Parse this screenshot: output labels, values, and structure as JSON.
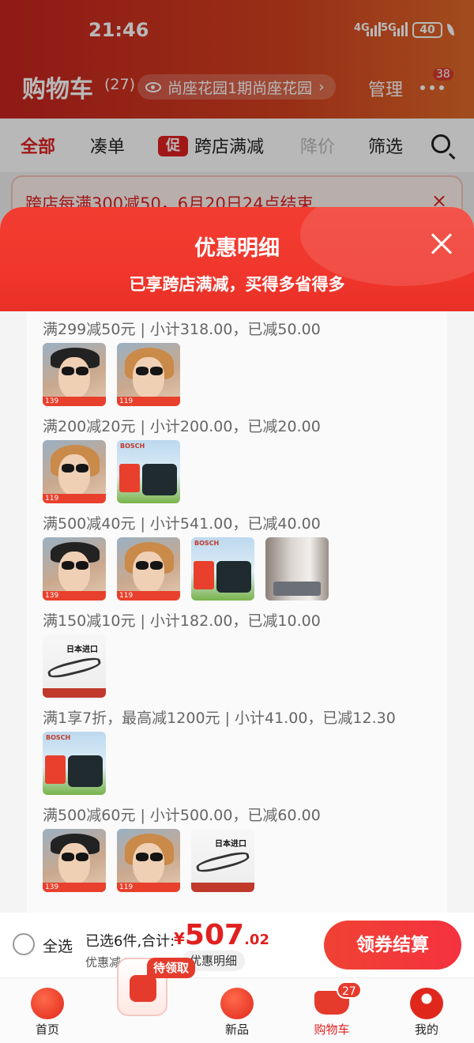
{
  "status": {
    "time": "21:46",
    "net1": "4G",
    "net2": "5G",
    "battery": "40"
  },
  "header": {
    "title": "购物车",
    "count": "(27)",
    "address": "尚座花园1期尚座花园",
    "address_chevron": "›",
    "manage": "管理",
    "msg_badge": "38"
  },
  "filters": {
    "all": "全部",
    "combine": "凑单",
    "promo_tag": "促",
    "cross_store": "跨店满减",
    "price_drop": "降价",
    "filter": "筛选"
  },
  "notice": {
    "text": "跨店每满300减50，6月20日24点结束",
    "close": "×"
  },
  "sheet": {
    "title": "优惠明细",
    "subtitle": "已享跨店满减，买得多省得多",
    "groups": [
      {
        "title": "满299减50元 | 小计318.00，已减50.00",
        "items": [
          "glass-hat",
          "glass"
        ]
      },
      {
        "title": "满200减20元 | 小计200.00，已减20.00",
        "items": [
          "glass",
          "bosch"
        ]
      },
      {
        "title": "满500减40元 | 小计541.00，已减40.00",
        "items": [
          "glass-hat",
          "glass",
          "bosch",
          "room"
        ]
      },
      {
        "title": "满150减10元 | 小计182.00，已减10.00",
        "items": [
          "eyewear"
        ]
      },
      {
        "title": "满1享7折，最高减1200元 | 小计41.00，已减12.30",
        "items": [
          "bosch"
        ]
      },
      {
        "title": "满500减60元 | 小计500.00，已减60.00",
        "items": [
          "glass-hat",
          "glass",
          "eyewear"
        ]
      }
    ],
    "thumb_labels": {
      "glass_price": "139",
      "glass2_price": "119",
      "bosch_logo": "BOSCH",
      "eyewear_text": "日本进口"
    }
  },
  "checkout": {
    "select_all": "全选",
    "summary": "已选6件,合计:",
    "currency": "¥",
    "total_int": "507",
    "total_dec": ".02",
    "discount": "优惠减:¥315.98",
    "detail": "优惠明细",
    "pay": "领券结算"
  },
  "tabbar": {
    "home": "首页",
    "coupon_tag": "待领取",
    "new": "新品",
    "cart": "购物车",
    "cart_badge": "27",
    "me": "我的"
  },
  "colors": {
    "accent": "#e02020",
    "sheet_head": "#f23c31"
  }
}
